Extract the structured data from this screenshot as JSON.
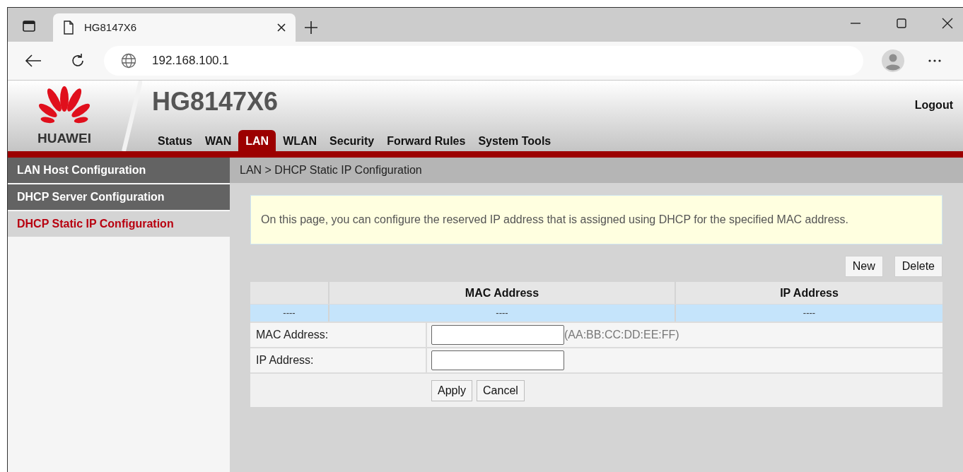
{
  "browser": {
    "tab_title": "HG8147X6",
    "url": "192.168.100.1"
  },
  "header": {
    "logo_text": "HUAWEI",
    "model": "HG8147X6",
    "logout": "Logout",
    "nav": [
      {
        "label": "Status",
        "selected": false
      },
      {
        "label": "WAN",
        "selected": false
      },
      {
        "label": "LAN",
        "selected": true
      },
      {
        "label": "WLAN",
        "selected": false
      },
      {
        "label": "Security",
        "selected": false
      },
      {
        "label": "Forward Rules",
        "selected": false
      },
      {
        "label": "System Tools",
        "selected": false
      }
    ]
  },
  "sidebar": {
    "items": [
      {
        "label": "LAN Host Configuration",
        "selected": false
      },
      {
        "label": "DHCP Server Configuration",
        "selected": false
      },
      {
        "label": "DHCP Static IP Configuration",
        "selected": true
      }
    ]
  },
  "breadcrumb": "LAN > DHCP Static IP Configuration",
  "notice": "On this page, you can configure the reserved IP address that is assigned using DHCP for the specified MAC address.",
  "actions": [
    "New",
    "Delete"
  ],
  "table": {
    "columns": [
      "",
      "MAC Address",
      "IP Address"
    ],
    "rows": [
      [
        "----",
        "----",
        "----"
      ]
    ]
  },
  "form": {
    "fields": [
      {
        "label": "MAC Address:",
        "hint": "(AA:BB:CC:DD:EE:FF)"
      },
      {
        "label": "IP Address:"
      }
    ],
    "buttons": [
      "Apply",
      "Cancel"
    ]
  }
}
